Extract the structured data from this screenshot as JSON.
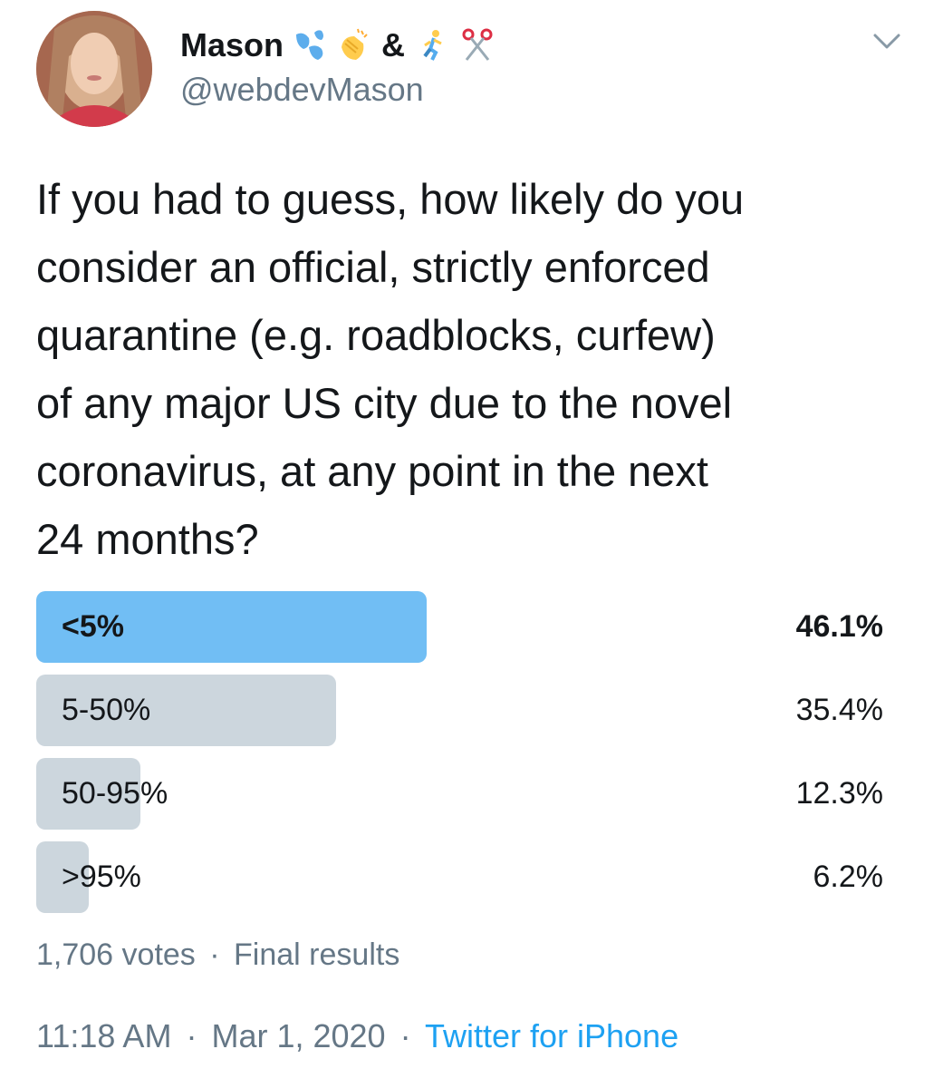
{
  "author": {
    "display_name": "Mason",
    "name_separator": "&",
    "handle": "@webdevMason",
    "emojis": [
      "sweat-droplets-emoji",
      "clapping-hands-emoji",
      "runner-emoji",
      "scissors-emoji"
    ]
  },
  "tweet": {
    "text": "If you had to guess, how likely do you\nconsider an official, strictly enforced\nquarantine (e.g. roadblocks, curfew)\nof any major US city due to the novel\ncoronavirus, at any point in the next\n24 months?"
  },
  "poll": {
    "options": [
      {
        "label": "<5%",
        "percent_text": "46.1%",
        "percent": 46.1,
        "winner": true
      },
      {
        "label": "5-50%",
        "percent_text": "35.4%",
        "percent": 35.4,
        "winner": false
      },
      {
        "label": "50-95%",
        "percent_text": "12.3%",
        "percent": 12.3,
        "winner": false
      },
      {
        "label": ">95%",
        "percent_text": "6.2%",
        "percent": 6.2,
        "winner": false
      }
    ],
    "votes": "1,706 votes",
    "meta_separator": "·",
    "status": "Final results"
  },
  "timestamp": {
    "time": "11:18 AM",
    "separator": "·",
    "date": "Mar 1, 2020",
    "source": "Twitter for iPhone"
  },
  "colors": {
    "winner_bar": "#71bef4",
    "other_bar": "#ccd6dd",
    "link": "#1da1f2",
    "secondary_text": "#657786",
    "primary_text": "#14171a"
  }
}
